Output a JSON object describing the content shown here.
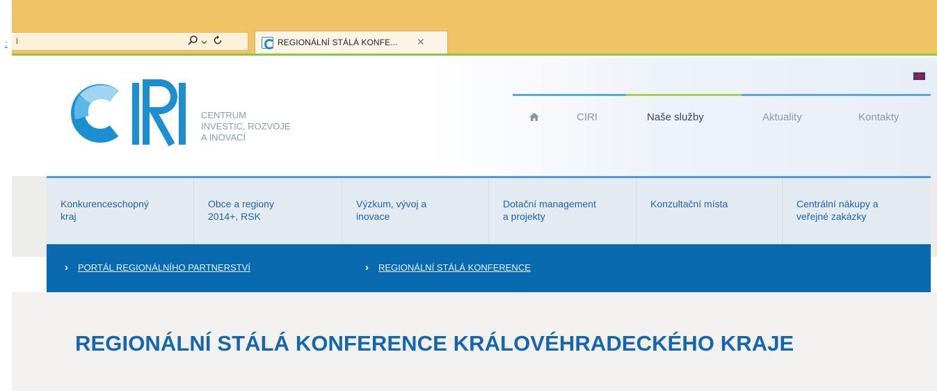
{
  "browser": {
    "address_text": "l",
    "tab_title": "REGIONÁLNÍ STÁLÁ KONFE...",
    "stray_link": ":",
    "icons": {
      "search": "search-icon",
      "dropdown": "chevron-down-icon",
      "refresh": "refresh-icon",
      "close": "close-icon",
      "favicon": "site-favicon-icon"
    }
  },
  "header": {
    "logo_text": "CIRI",
    "logo_subtitle": [
      "CENTRUM",
      "INVESTIC, ROZVOJE",
      "A INOVACÍ"
    ],
    "language_flag": "uk-flag-icon",
    "nav": [
      {
        "label": "",
        "icon": "home-icon"
      },
      {
        "label": "CIRI"
      },
      {
        "label": "Naše služby",
        "active": true
      },
      {
        "label": "Aktuality"
      },
      {
        "label": "Kontakty"
      }
    ]
  },
  "services": [
    {
      "label": "Konkurenceschopný\nkraj"
    },
    {
      "label": "Obce a regiony\n2014+, RSK"
    },
    {
      "label": "Výzkum, vývoj a\ninovace"
    },
    {
      "label": "Dotační management\na projekty"
    },
    {
      "label": "Konzultační místa"
    },
    {
      "label": "Centrální nákupy a\nveřejné zakázky"
    }
  ],
  "breadcrumb": [
    {
      "label": "PORTÁL REGIONÁLNÍHO PARTNERSTVÍ"
    },
    {
      "label": "REGIONÁLNÍ STÁLÁ KONFERENCE"
    }
  ],
  "page": {
    "title": "REGIONÁLNÍ STÁLÁ KONFERENCE KRÁLOVÉHRADECKÉHO KRAJE"
  },
  "colors": {
    "browser_bar": "#f0c465",
    "accent_green": "#8cc53f",
    "nav_blue": "#5aa7df",
    "breadcrumb_bg": "#0a6ab0",
    "title_blue": "#1466b0",
    "menu_text": "#2064a6"
  }
}
